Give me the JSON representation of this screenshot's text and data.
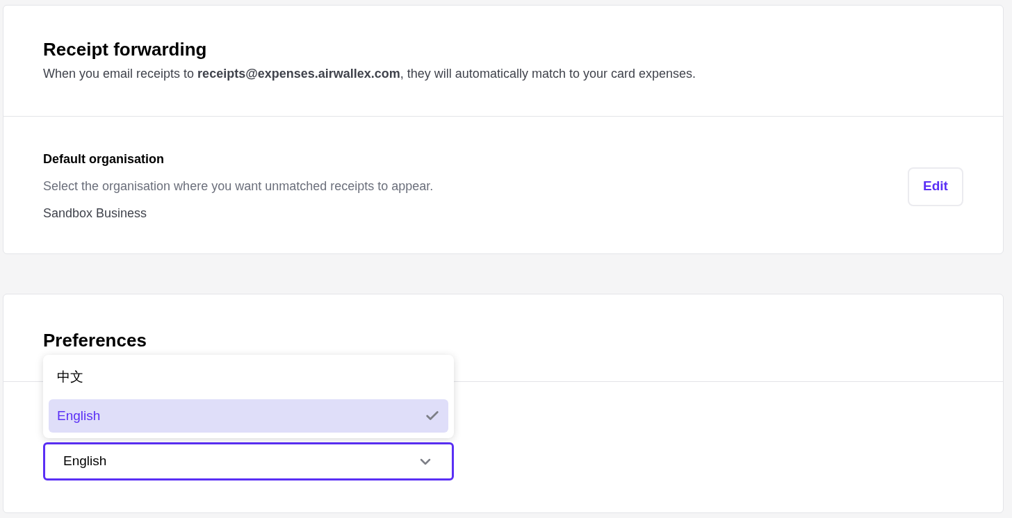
{
  "receipt_forwarding": {
    "title": "Receipt forwarding",
    "description": "When you email receipts to **receipts@expenses.airwallex.com**, they will automatically match to your card expenses."
  },
  "default_organisation": {
    "title": "Default organisation",
    "description": "Select the organisation where you want unmatched receipts to appear.",
    "value": "Sandbox Business",
    "button": "Edit"
  },
  "preferences": {
    "title": "Preferences",
    "select": {
      "value": "English",
      "expanded": true,
      "options": [
        {
          "label": "中文",
          "selected": false
        },
        {
          "label": "English",
          "selected": true
        }
      ]
    }
  }
}
